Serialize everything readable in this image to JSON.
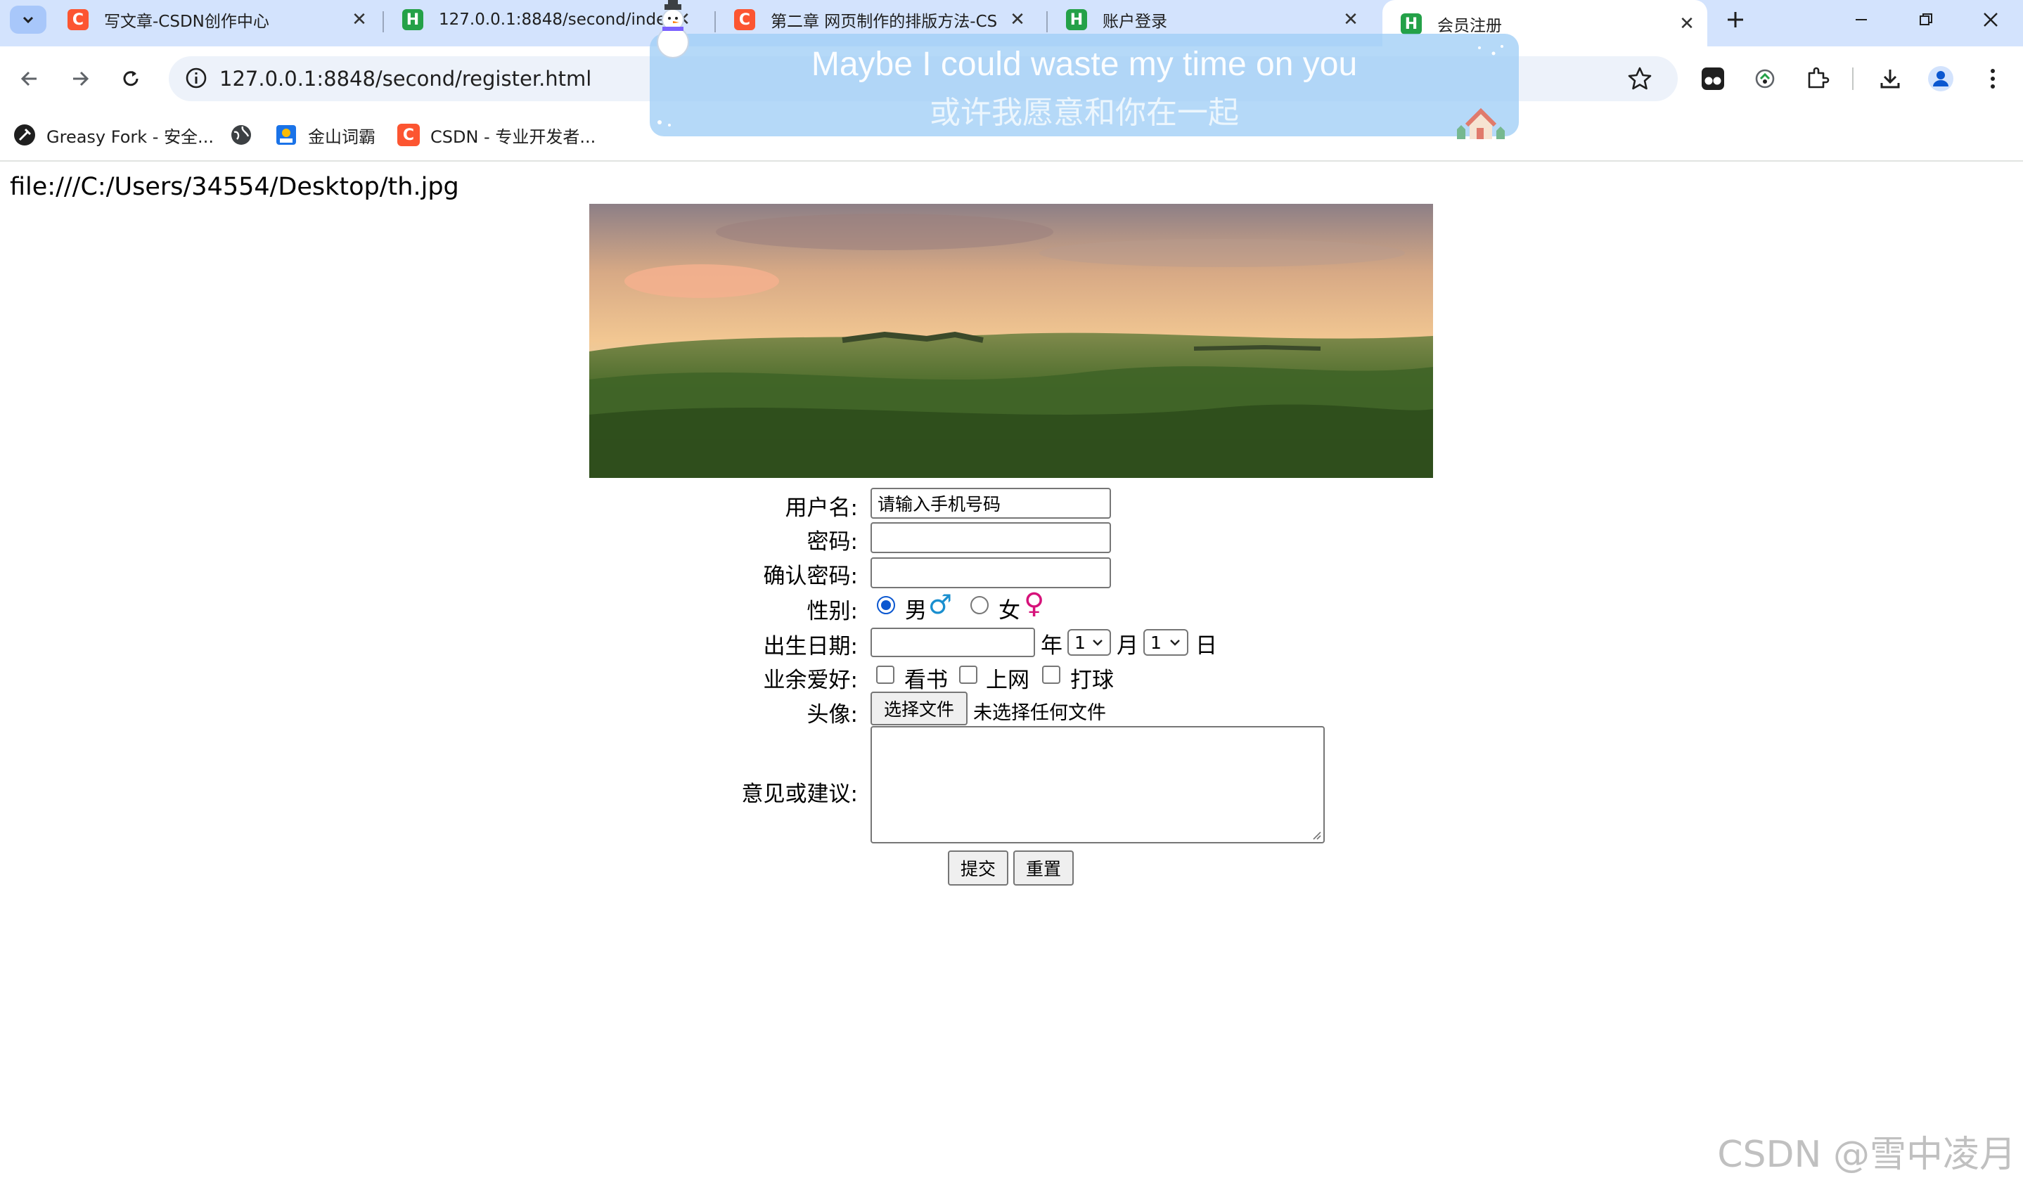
{
  "browser": {
    "tabs": [
      {
        "favicon": "C",
        "title": "写文章-CSDN创作中心"
      },
      {
        "favicon": "H",
        "title": "127.0.0.1:8848/second/inde"
      },
      {
        "favicon": "C",
        "title": "第二章 网页制作的排版方法-CS"
      },
      {
        "favicon": "H",
        "title": "账户登录"
      },
      {
        "favicon": "H",
        "title": "会员注册",
        "active": true
      }
    ],
    "url": "127.0.0.1:8848/second/register.html",
    "bookmarks": [
      {
        "icon": "greasyfork-icon",
        "label": "Greasy Fork - 安全..."
      },
      {
        "icon": "globe-icon",
        "label": ""
      },
      {
        "icon": "jinshan-icon",
        "label": "金山词霸"
      },
      {
        "icon": "csdn-icon",
        "label": "CSDN - 专业开发者..."
      }
    ],
    "colors": {
      "tabstrip": "#d3e3fd",
      "omnibox": "#edf2fa",
      "radio_accent": "#0b57d0",
      "csdn": "#fc5531",
      "hbuilder": "#24a148"
    }
  },
  "lyric": {
    "line1": "Maybe I could waste my time on you",
    "line2": "或许我愿意和你在一起"
  },
  "page": {
    "image_caption": "file:///C:/Users/34554/Desktop/th.jpg",
    "form": {
      "username_label": "用户名:",
      "username_value": "请输入手机号码",
      "password_label": "密码:",
      "confirm_label": "确认密码:",
      "gender_label": "性别:",
      "gender_options": [
        {
          "label": "男",
          "symbol": "♂",
          "checked": true
        },
        {
          "label": "女",
          "symbol": "♀",
          "checked": false
        }
      ],
      "birthdate_label": "出生日期:",
      "year_suffix": "年",
      "month_value": "1",
      "month_suffix": "月",
      "day_value": "1",
      "day_suffix": "日",
      "hobbies_label": "业余爱好:",
      "hobbies": [
        "看书",
        "上网",
        "打球"
      ],
      "avatar_label": "头像:",
      "file_button": "选择文件",
      "file_status": "未选择任何文件",
      "comment_label": "意见或建议:",
      "submit_label": "提交",
      "reset_label": "重置"
    }
  },
  "watermark": "CSDN @雪中凌月"
}
